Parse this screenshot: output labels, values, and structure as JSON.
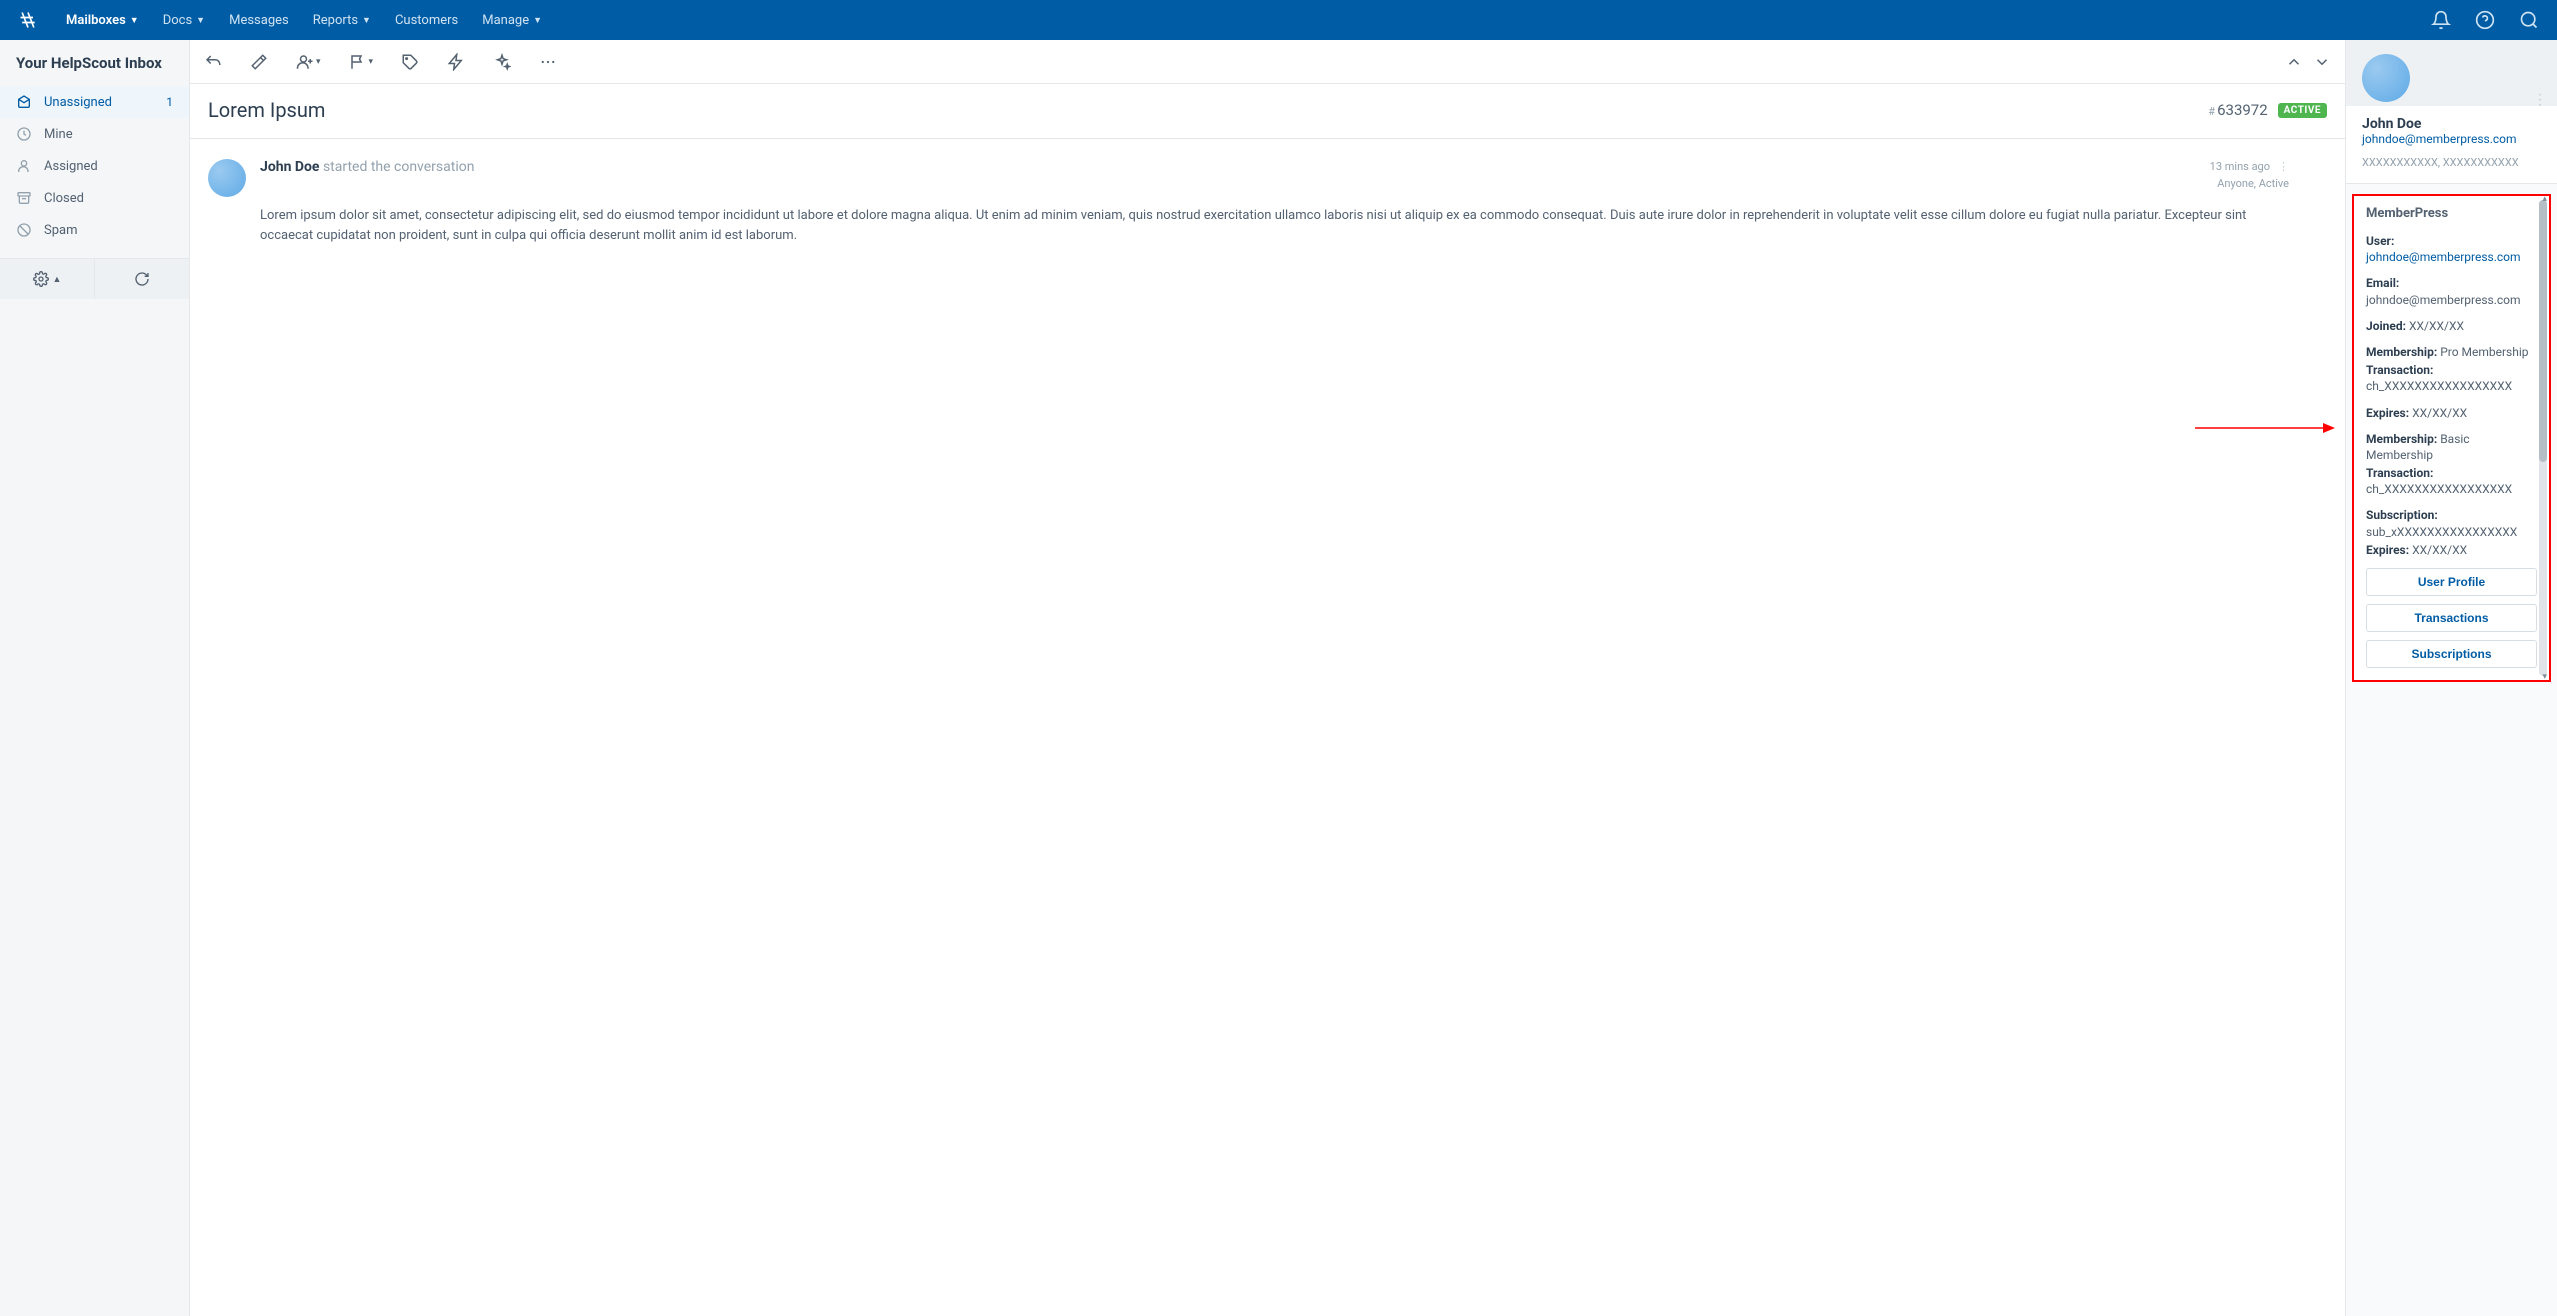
{
  "nav": {
    "items": [
      "Mailboxes",
      "Docs",
      "Messages",
      "Reports",
      "Customers",
      "Manage"
    ],
    "dropdowns": [
      true,
      true,
      false,
      true,
      false,
      true
    ],
    "activeIndex": 0
  },
  "sidebar": {
    "title": "Your HelpScout Inbox",
    "items": [
      {
        "label": "Unassigned",
        "count": "1",
        "active": true
      },
      {
        "label": "Mine"
      },
      {
        "label": "Assigned"
      },
      {
        "label": "Closed"
      },
      {
        "label": "Spam"
      }
    ]
  },
  "conversation": {
    "subject": "Lorem Ipsum",
    "number": "633972",
    "status": "ACTIVE",
    "author": "John Doe",
    "actionText": "started the conversation",
    "time": "13 mins ago",
    "visibility": "Anyone, Active",
    "body": "Lorem ipsum dolor sit amet, consectetur adipiscing elit, sed do eiusmod tempor incididunt ut labore et dolore magna aliqua. Ut enim ad minim veniam, quis nostrud exercitation ullamco laboris nisi ut aliquip ex ea commodo consequat. Duis aute irure dolor in reprehenderit in voluptate velit esse cillum dolore eu fugiat nulla pariatur. Excepteur sint occaecat cupidatat non proident, sunt in culpa qui officia deserunt mollit anim id est laborum."
  },
  "customer": {
    "name": "John Doe",
    "email": "johndoe@memberpress.com",
    "extra": "XXXXXXXXXXX, XXXXXXXXXXX"
  },
  "widget": {
    "title": "MemberPress",
    "userLabel": "User:",
    "userValue": "johndoe@memberpress.com",
    "emailLabel": "Email:",
    "emailValue": "johndoe@memberpress.com",
    "joinedLabel": "Joined:",
    "joinedValue": "XX/XX/XX",
    "m1Label": "Membership:",
    "m1Value": "Pro Membership",
    "t1Label": "Transaction:",
    "t1Value": "ch_XXXXXXXXXXXXXXXXX",
    "e1Label": "Expires:",
    "e1Value": "XX/XX/XX",
    "m2Label": "Membership:",
    "m2Value": "Basic Membership",
    "t2Label": "Transaction:",
    "t2Value": "ch_XXXXXXXXXXXXXXXXX",
    "subLabel": "Subscription:",
    "subValue": "sub_xXXXXXXXXXXXXXXXX",
    "e2Label": "Expires:",
    "e2Value": "XX/XX/XX",
    "buttons": [
      "User Profile",
      "Transactions",
      "Subscriptions"
    ]
  }
}
